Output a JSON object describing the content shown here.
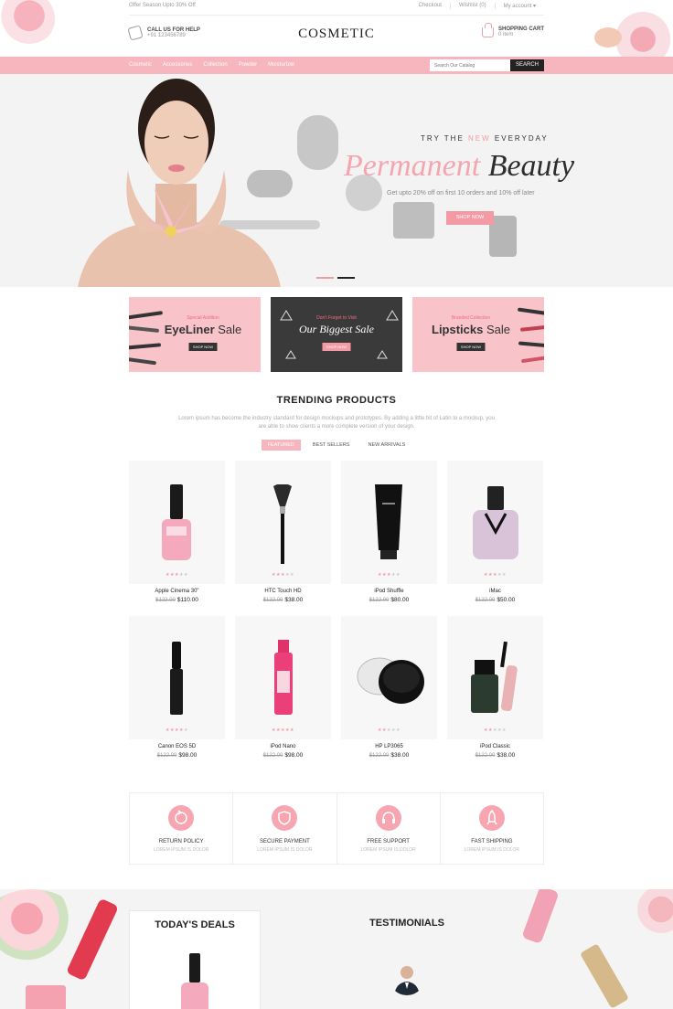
{
  "topbar": {
    "offer": "Offer Season Upto 30% Off",
    "links": [
      "Checkout",
      "Wishlist (0)",
      "My account ▾"
    ]
  },
  "header": {
    "help_title": "CALL US FOR HELP",
    "help_phone": "+91 123456789",
    "logo": "COSMETIC",
    "cart_title": "SHOPPING CART",
    "cart_amount": "0 item"
  },
  "nav": {
    "items": [
      "Cosmetic",
      "Accessories",
      "Collection",
      "Powder",
      "Moisturizer"
    ],
    "search_placeholder": "Search Our Catalog",
    "search_button": "SEARCH"
  },
  "hero": {
    "kicker_pre": "TRY THE ",
    "kicker_new": "NEW",
    "kicker_post": " EVERYDAY",
    "headline_a": "Permanent ",
    "headline_b": "Beauty",
    "sub": "Get upto 20% off on first 10 orders and 10% off later",
    "button": "SHOP NOW"
  },
  "banners": [
    {
      "kicker": "Special Addition",
      "title_a": "EyeLiner ",
      "title_b": "Sale",
      "button": "SHOP NOW"
    },
    {
      "kicker": "Don't Forget to Visit",
      "title_a": "Our Biggest ",
      "title_b": "Sale",
      "button": "SHOP NOW"
    },
    {
      "kicker": "Branded Collection",
      "title_a": "Lipsticks ",
      "title_b": "Sale",
      "button": "SHOP NOW"
    }
  ],
  "trending": {
    "title": "TRENDING PRODUCTS",
    "desc": "Lorem ipsum has become the industry standard for design mockups and prototypes. By adding a little bit of Latin to a mockup, you are able to show clients a more complete version of your design.",
    "tabs": [
      "FEATURED",
      "BEST SELLERS",
      "NEW ARRIVALS"
    ]
  },
  "products": [
    {
      "name": "Apple Cinema 30\"",
      "old": "$122.00",
      "price": "$110.00",
      "rating": 3
    },
    {
      "name": "HTC Touch HD",
      "old": "$122.00",
      "price": "$38.00",
      "rating": 3
    },
    {
      "name": "iPod Shuffle",
      "old": "$122.00",
      "price": "$80.00",
      "rating": 3
    },
    {
      "name": "iMac",
      "old": "$122.00",
      "price": "$50.00",
      "rating": 3
    },
    {
      "name": "Canon EOS 5D",
      "old": "$122.00",
      "price": "$98.00",
      "rating": 4
    },
    {
      "name": "iPod Nano",
      "old": "$122.00",
      "price": "$98.00",
      "rating": 5
    },
    {
      "name": "HP LP3065",
      "old": "$122.00",
      "price": "$38.00",
      "rating": 2
    },
    {
      "name": "iPod Classic",
      "old": "$122.00",
      "price": "$38.00",
      "rating": 2
    }
  ],
  "features": [
    {
      "title": "RETURN POLICY",
      "sub": "LOREM IPSUM IS DOLOR",
      "icon": "return-icon"
    },
    {
      "title": "SECURE PAYMENT",
      "sub": "LOREM IPSUM IS DOLOR",
      "icon": "shield-icon"
    },
    {
      "title": "FREE SUPPORT",
      "sub": "LOREM IPSUM IS DOLOR",
      "icon": "headset-icon"
    },
    {
      "title": "FAST SHIPPING",
      "sub": "LOREM IPSUM IS DOLOR",
      "icon": "rocket-icon"
    }
  ],
  "bottom": {
    "deals_title": "TODAY'S DEALS",
    "testimonials_title": "TESTIMONIALS"
  },
  "colors": {
    "accent": "#f7b5bd",
    "accent_dark": "#f39aa5",
    "dark": "#222222"
  }
}
